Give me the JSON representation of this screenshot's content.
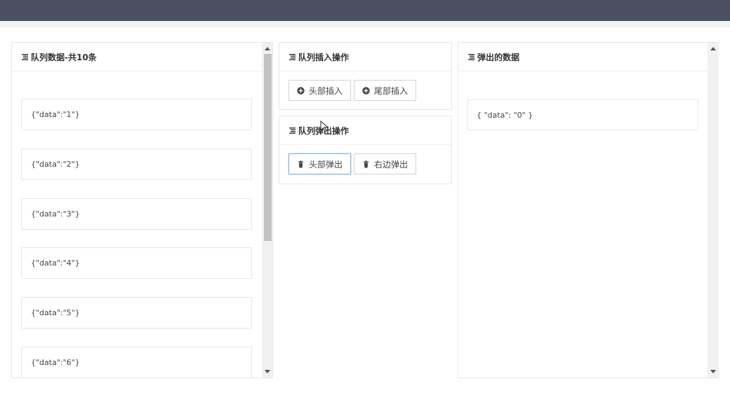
{
  "queue": {
    "title": "队列数据-共10条",
    "items": [
      {
        "text": "{\"data\":\"1\"}"
      },
      {
        "text": "{\"data\":\"2\"}"
      },
      {
        "text": "{\"data\":\"3\"}"
      },
      {
        "text": "{\"data\":\"4\"}"
      },
      {
        "text": "{\"data\":\"5\"}"
      },
      {
        "text": "{\"data\":\"6\"}"
      }
    ]
  },
  "insert": {
    "title": "队列插入操作",
    "head_insert_label": "头部插入",
    "tail_insert_label": "尾部插入"
  },
  "pop": {
    "title": "队列弹出操作",
    "head_pop_label": "头部弹出",
    "right_pop_label": "右边弹出"
  },
  "popped": {
    "title": "弹出的数据",
    "value": "{ \"data\": \"0\" }"
  },
  "icons": {
    "list": "list-icon",
    "plus": "plus-circle-icon",
    "trash": "trash-icon"
  }
}
